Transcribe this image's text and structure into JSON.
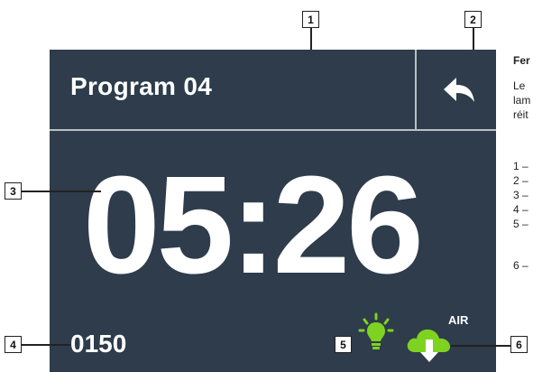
{
  "screen": {
    "program_title": "Program 04",
    "time": "05:26",
    "count": "0150",
    "air_label": "AIR",
    "colors": {
      "panel_bg": "#2e3c4b",
      "divider": "#b9c0c6",
      "text": "#ffffff",
      "bulb": "#7ed321",
      "cloud": "#7ed321"
    },
    "icons": {
      "back": "back-arrow-icon",
      "bulb": "lightbulb-icon",
      "air": "cloud-download-icon"
    }
  },
  "callouts": [
    "1",
    "2",
    "3",
    "4",
    "5",
    "6"
  ],
  "side_text": {
    "heading": "Fer",
    "line1": "Le",
    "line2": "lam",
    "line3": "réit"
  },
  "legend": [
    "1 –",
    "2 –",
    "3 –",
    "4 –",
    "5 –",
    "6 –"
  ]
}
